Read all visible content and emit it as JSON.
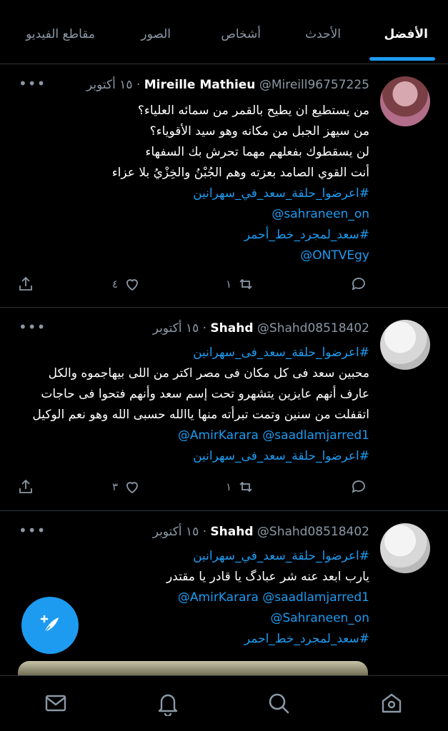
{
  "tabs": [
    {
      "label": "الأفضل",
      "active": true
    },
    {
      "label": "الأحدث",
      "active": false
    },
    {
      "label": "أشخاص",
      "active": false
    },
    {
      "label": "الصور",
      "active": false
    },
    {
      "label": "مقاطع الفيديو",
      "active": false
    }
  ],
  "tweets": [
    {
      "name": "Mireille Mathieu",
      "handle": "@Mireill96757225",
      "separator": "·",
      "date": "١٥ أكتوبر",
      "lines": [
        {
          "text": "من يستطيع ان يطيح بالقمر من سمائه العلياء؟",
          "link": false
        },
        {
          "text": "من سيهز الجبل من مكانه وهو سيد الأقوياء؟",
          "link": false
        },
        {
          "text": "لن يسقطوك بفعلهم مهما تحرش بك السفهاء",
          "link": false
        },
        {
          "text": "أنت القوي الصامد بعزته وهم الجُبْنُ والخِزْيُ بلا عزاء",
          "link": false
        },
        {
          "text": "#اعرضوا_حلقة_سعد_في_سهرانين",
          "link": true
        },
        {
          "text": "@sahraneen_on",
          "link": true
        },
        {
          "text": "#سعد_لمجرد_خط_أحمر",
          "link": true
        },
        {
          "text": "@ONTVEgy",
          "link": true
        }
      ],
      "replies": "",
      "retweets": "١",
      "likes": "٤"
    },
    {
      "name": "Shahd",
      "handle": "@Shahd08518402",
      "separator": "·",
      "date": "١٥ أكتوبر",
      "lines": [
        {
          "text": "#اعرضوا_حلقة_سعد_فى_سهرانين",
          "link": true
        },
        {
          "text": "محبين سعد فى كل مكان فى مصر اكتر من اللى بيهاجموه والكل",
          "link": false
        },
        {
          "text": "عارف أنهم عايزين يتشهرو تحت إسم سعد وأنهم فتحوا فى حاجات",
          "link": false
        },
        {
          "text": "اتقفلت من سنين وتمت تبرأته منها ياالله حسبى الله وهو نعم الوكيل",
          "link": false
        },
        {
          "text": "@AmirKarara @saadlamjarred1",
          "link": true
        },
        {
          "text": "#اعرضوا_حلقة_سعد_فى_سهرانين",
          "link": true
        }
      ],
      "replies": "",
      "retweets": "١",
      "likes": "٣"
    },
    {
      "name": "Shahd",
      "handle": "@Shahd08518402",
      "separator": "·",
      "date": "١٥ أكتوبر",
      "lines": [
        {
          "text": "#اعرضوا_حلقة_سعد_في_سهرانين",
          "link": true
        },
        {
          "text": "يارب ابعد عنه شر عبادگ يا قادر يا مقتدر",
          "link": false
        },
        {
          "text": "@AmirKarara  @saadlamjarred1",
          "link": true
        },
        {
          "text": "@Sahraneen_on",
          "link": true
        },
        {
          "text": "#سعد_لمجرد_خط_احمر",
          "link": true
        }
      ]
    }
  ],
  "icons": {
    "more": "more-icon",
    "reply": "reply-icon",
    "retweet": "retweet-icon",
    "like": "heart-icon",
    "share": "share-icon",
    "compose": "compose-icon",
    "nav": [
      "home-icon",
      "search-icon",
      "notifications-icon",
      "messages-icon"
    ]
  },
  "colors": {
    "accent": "#1d9bf0",
    "background": "#000000",
    "muted": "#8b98a5"
  }
}
